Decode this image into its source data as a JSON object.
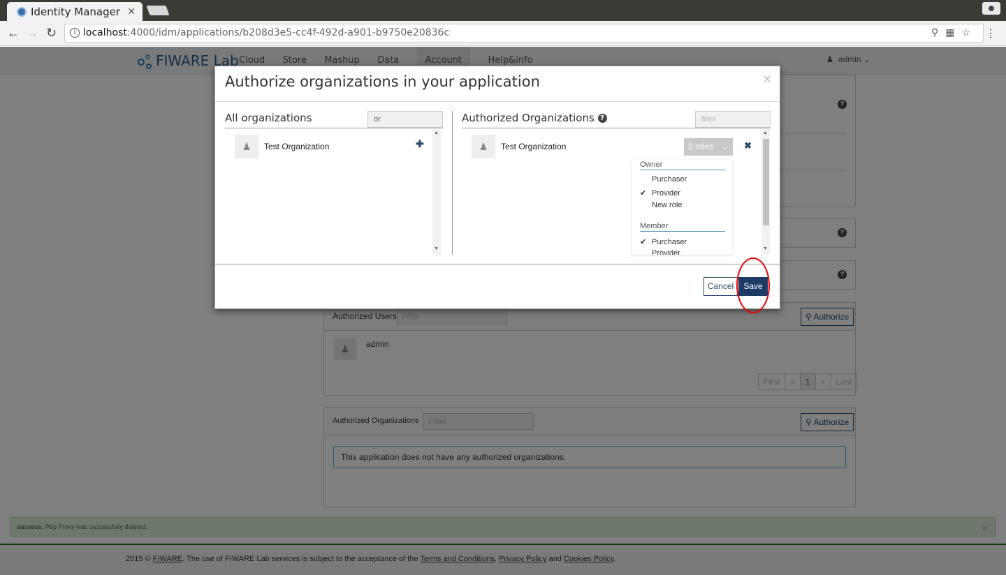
{
  "browser": {
    "tab_title": "Identity Manager",
    "tab_close": "✕",
    "url_host": "localhost",
    "url_path": ":4000/idm/applications/b208d3e5-cc4f-492d-a901-b9750e20836c"
  },
  "site": {
    "logo_text": "FIWARE Lab",
    "nav": [
      "Cloud",
      "Store",
      "Mashup",
      "Data",
      "Account",
      "Help&info"
    ],
    "user": "admin"
  },
  "background": {
    "authorized_users_label": "Authorized Users",
    "authorized_users_filter_placeholder": "Filter",
    "authorize_label": "Authorize",
    "user_name": "admin",
    "pager": [
      "First",
      "«",
      "1",
      "»",
      "Last"
    ],
    "authorized_orgs_label": "Authorized Organizations",
    "authorized_orgs_filter_placeholder": "Filter",
    "no_orgs_message": "This application does not have any authorized organizations.",
    "success_label": "success:",
    "success_message": "Pep Proxy was successfully deleted.",
    "footer": {
      "prefix": "2015 ©",
      "fiware": "FIWARE",
      "middle": ". The use of FIWARE Lab services is subject to the acceptance of the",
      "terms": "Terms and Conditions",
      "privacy": "Privacy Policy",
      "and": "and",
      "cookies": "Cookies Policy"
    }
  },
  "modal": {
    "title": "Authorize organizations in your application",
    "close": "×",
    "left": {
      "title": "All organizations",
      "filter_value": "or",
      "items": [
        {
          "name": "Test Organization"
        }
      ]
    },
    "right": {
      "title": "Authorized Organizations",
      "filter_placeholder": "filter",
      "items": [
        {
          "name": "Test Organization",
          "roles_label": "2 roles"
        }
      ],
      "role_groups": [
        {
          "name": "Owner",
          "roles": [
            {
              "name": "Purchaser",
              "checked": false
            },
            {
              "name": "Provider",
              "checked": true
            },
            {
              "name": "New role",
              "checked": false
            }
          ]
        },
        {
          "name": "Member",
          "roles": [
            {
              "name": "Purchaser",
              "checked": true
            },
            {
              "name": "Provider",
              "checked": false
            }
          ]
        }
      ]
    },
    "cancel_label": "Cancel",
    "save_label": "Save"
  },
  "colors": {
    "primary": "#1d3a64",
    "highlight_circle": "#ee0000",
    "success_bg": "#dff0d8"
  }
}
